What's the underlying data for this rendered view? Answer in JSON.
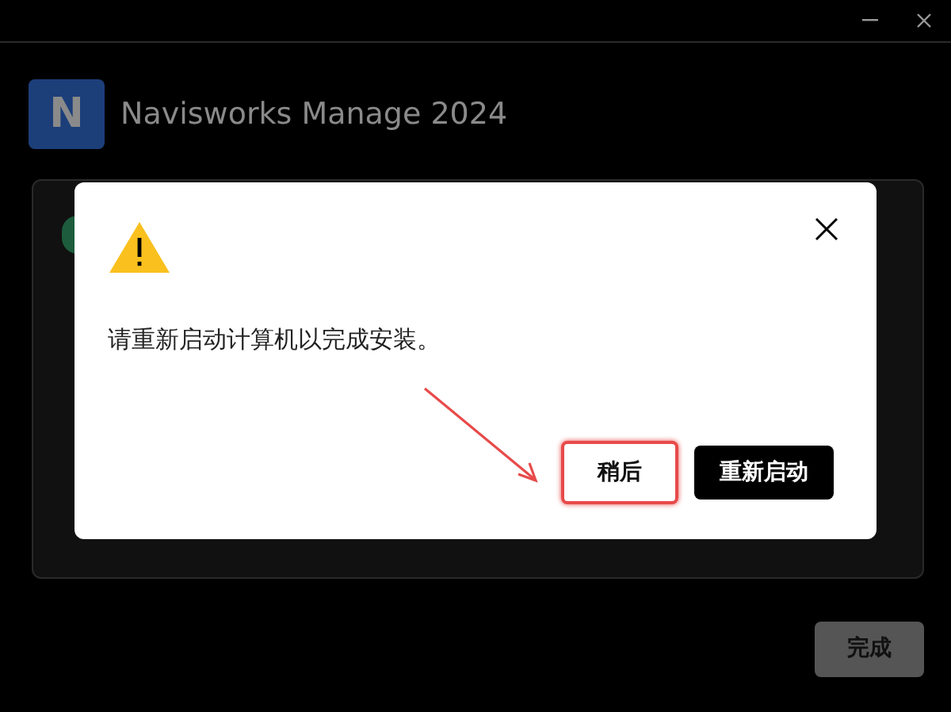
{
  "window": {
    "product_title": "Navisworks Manage 2024",
    "logo_letter": "N"
  },
  "dialog": {
    "message": "请重新启动计算机以完成安装。",
    "buttons": [
      {
        "label": "稍后",
        "kind": "secondary",
        "highlighted": true
      },
      {
        "label": "重新启动",
        "kind": "primary",
        "highlighted": false
      }
    ]
  },
  "footer": {
    "done_button": {
      "label": "完成",
      "disabled": true
    }
  }
}
